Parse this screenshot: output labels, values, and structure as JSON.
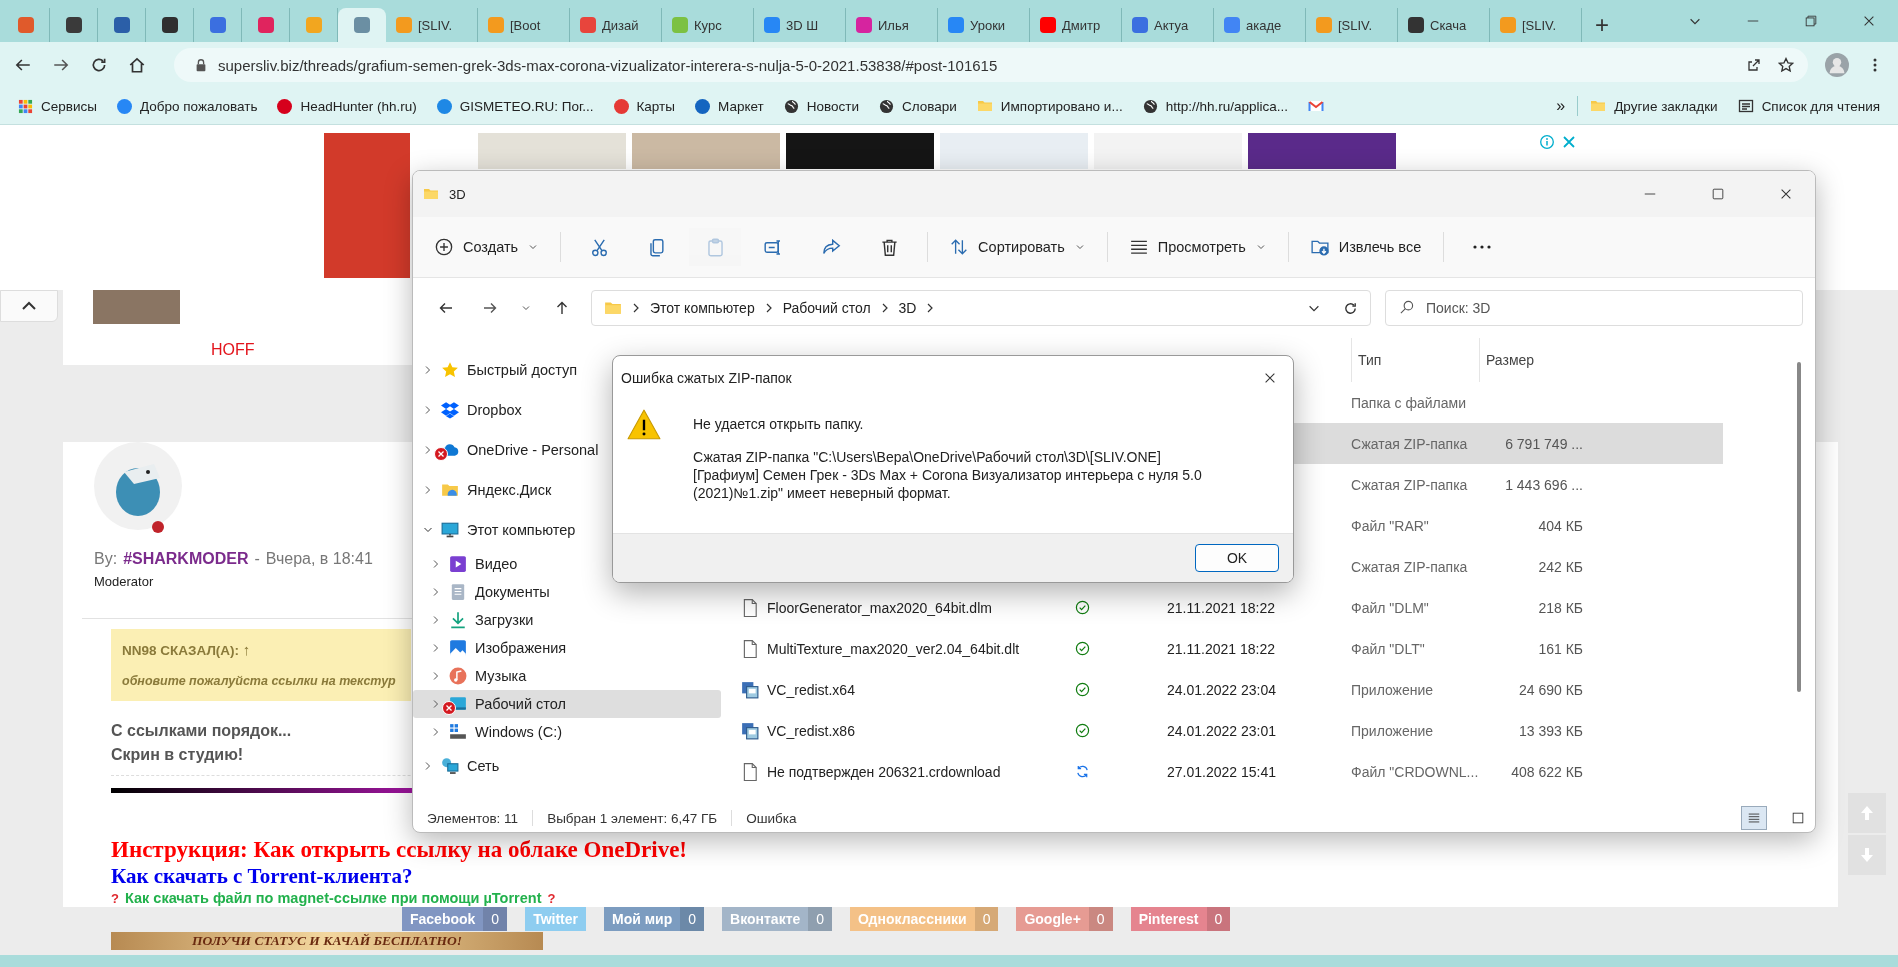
{
  "browser": {
    "tabs": [
      {
        "color": "#e05a2b",
        "selected": false
      },
      {
        "color": "#3a3a3a",
        "selected": false
      },
      {
        "color": "#2b5fa8",
        "selected": false
      },
      {
        "color": "#2f2f2f",
        "selected": false
      },
      {
        "color": "#3b6fe0",
        "selected": false
      },
      {
        "color": "#e0245e",
        "selected": false
      },
      {
        "color": "#f2a61f",
        "selected": false
      },
      {
        "color": "#6b8fa3",
        "selected": true
      },
      {
        "title": "[SLIV.",
        "color": "#f39a1e",
        "selected": false
      },
      {
        "title": "[Boot",
        "color": "#f39a1e",
        "selected": false
      },
      {
        "title": "Дизай",
        "color": "#e8453c",
        "selected": false
      },
      {
        "title": "Курс",
        "color": "#7cc142",
        "selected": false
      },
      {
        "title": "3D Ш",
        "color": "#2787f5",
        "selected": false
      },
      {
        "title": "Илья",
        "color": "#d6249f",
        "selected": false
      },
      {
        "title": "Уроки",
        "color": "#2787f5",
        "selected": false
      },
      {
        "title": "Дмитр",
        "color": "#ff0000",
        "selected": false
      },
      {
        "title": "Актуа",
        "color": "#3b6fe0",
        "selected": false
      },
      {
        "title": "акаде",
        "color": "#4285f4",
        "selected": false
      },
      {
        "title": "[SLIV.",
        "color": "#f39a1e",
        "selected": false
      },
      {
        "title": "Скача",
        "color": "#333333",
        "selected": false
      },
      {
        "title": "[SLIV.",
        "color": "#f39a1e",
        "selected": false
      }
    ],
    "new_tab": "+",
    "url": "supersliv.biz/threads/grafium-semen-grek-3ds-max-corona-vizualizator-interera-s-nulja-5-0-2021.53838/#post-101615",
    "bookmarks": [
      {
        "kind": "apps",
        "label": "Сервисы"
      },
      {
        "kind": "site",
        "label": "Добро пожаловать",
        "color": "#2787f5"
      },
      {
        "kind": "site",
        "label": "HeadHunter (hh.ru)",
        "color": "#d6001c"
      },
      {
        "kind": "site",
        "label": "GISMETEO.RU: Пог...",
        "color": "#1e88e5"
      },
      {
        "kind": "site",
        "label": "Карты",
        "color": "#e53935"
      },
      {
        "kind": "site",
        "label": "Маркет",
        "color": "#1565c0"
      },
      {
        "kind": "globe",
        "label": "Новости"
      },
      {
        "kind": "globe",
        "label": "Словари"
      },
      {
        "kind": "folder",
        "label": "Импортировано и..."
      },
      {
        "kind": "globe",
        "label": "http://hh.ru/applica..."
      },
      {
        "kind": "mail"
      },
      {
        "kind": "more",
        "label": "»"
      },
      {
        "kind": "folder",
        "label": "Другие закладки"
      },
      {
        "kind": "list",
        "label": "Список для чтения"
      }
    ]
  },
  "page": {
    "ad_covers": [
      {
        "color": "#d23a2a"
      },
      {
        "color": "#e4e1d8"
      },
      {
        "color": "#cbb9a3"
      },
      {
        "color": "#151515"
      },
      {
        "color": "#e8eef3"
      },
      {
        "color": "#f3f3f3"
      },
      {
        "color": "#5a2a8a"
      }
    ],
    "hoff_caption": "HOFF",
    "post": {
      "author_prefix": "By:",
      "author": "#SHARKMODER",
      "separator": "-",
      "time": "Вчера, в 18:41",
      "role": "Moderator",
      "online": false,
      "quote": {
        "header": "NN98 СКАЗАЛ(А):",
        "arrow": "↑",
        "text": "обновите пожалуйста ссылки на текстур"
      },
      "lines": [
        "С ссылками порядок...",
        "Скрин в студию!"
      ],
      "links": [
        {
          "kind": "instruction",
          "text": "Инструкция: Как открыть ссылку на облаке OneDrive!"
        },
        {
          "kind": "torrent",
          "text": "Как скачать с Torrent-клиента?"
        },
        {
          "kind": "magnet",
          "text": "Как скачать файл по magnet-ссылке при помощи µTorrent",
          "mark": "?"
        }
      ]
    },
    "share": [
      {
        "label": "Facebook",
        "count": "0",
        "color": "#8196c2"
      },
      {
        "label": "Twitter",
        "color": "#8ecdf0"
      },
      {
        "label": "Мой мир",
        "count": "0",
        "color": "#7c9cc0"
      },
      {
        "label": "Вконтакте",
        "count": "0",
        "color": "#a3b5c8"
      },
      {
        "label": "Одноклассники",
        "count": "0",
        "color": "#f4c187"
      },
      {
        "label": "Google+",
        "count": "0",
        "color": "#e69b93"
      },
      {
        "label": "Pinterest",
        "count": "0",
        "color": "#e5848f"
      }
    ],
    "banner": "ПОЛУЧИ СТАТУС И КАЧАЙ БЕСПЛАТНО!"
  },
  "explorer": {
    "title": "3D",
    "toolbar": [
      {
        "kind": "menu",
        "label": "Создать",
        "dropdown": true
      },
      {
        "kind": "separator"
      },
      {
        "kind": "icon",
        "disabled": false
      },
      {
        "kind": "icon",
        "disabled": false
      },
      {
        "kind": "icon",
        "disabled": true
      },
      {
        "kind": "icon",
        "disabled": false
      },
      {
        "kind": "icon",
        "disabled": false
      },
      {
        "kind": "icon",
        "disabled": false
      },
      {
        "kind": "separator"
      },
      {
        "kind": "menu",
        "label": "Сортировать",
        "dropdown": true
      },
      {
        "kind": "separator"
      },
      {
        "kind": "menu",
        "label": "Просмотреть",
        "dropdown": true
      },
      {
        "kind": "separator"
      },
      {
        "kind": "menu",
        "label": "Извлечь все",
        "dropdown": false
      },
      {
        "kind": "separator"
      },
      {
        "kind": "more"
      }
    ],
    "breadcrumb": [
      "Этот компьютер",
      "Рабочий стол",
      "3D"
    ],
    "search": {
      "placeholder": "Поиск: 3D"
    },
    "tree": [
      {
        "label": "Быстрый доступ",
        "expanded": false,
        "selected": false,
        "error": false
      },
      {
        "label": "Dropbox",
        "expanded": false,
        "selected": false,
        "error": false
      },
      {
        "label": "OneDrive - Personal",
        "expanded": false,
        "selected": false,
        "error": true
      },
      {
        "label": "Яндекс.Диск",
        "expanded": false,
        "selected": false,
        "error": false
      },
      {
        "label": "Этот компьютер",
        "expanded": true,
        "selected": false,
        "error": false,
        "children": [
          {
            "label": "Видео",
            "expanded": false,
            "selected": false,
            "error": false
          },
          {
            "label": "Документы",
            "expanded": false,
            "selected": false,
            "error": false
          },
          {
            "label": "Загрузки",
            "expanded": false,
            "selected": false,
            "error": false
          },
          {
            "label": "Изображения",
            "expanded": false,
            "selected": false,
            "error": false
          },
          {
            "label": "Музыка",
            "expanded": false,
            "selected": false,
            "error": false
          },
          {
            "label": "Рабочий стол",
            "expanded": false,
            "selected": true,
            "error": true
          },
          {
            "label": "Windows (C:)",
            "expanded": false,
            "selected": false,
            "error": false
          }
        ]
      },
      {
        "label": "Сеть",
        "expanded": false,
        "selected": false,
        "error": false
      }
    ],
    "columns": [
      "Тип",
      "Размер"
    ],
    "rows": [
      {
        "type": "Папка с файлами",
        "selected": false
      },
      {
        "type": "Сжатая ZIP-папка",
        "size": "6 791 749 ...",
        "selected": true
      },
      {
        "type": "Сжатая ZIP-папка",
        "size": "1 443 696 ...",
        "selected": false
      },
      {
        "type": "Файл \"RAR\"",
        "size": "404 КБ",
        "selected": false
      },
      {
        "type": "Сжатая ZIP-папка",
        "size": "242 КБ",
        "selected": false
      },
      {
        "kind": "file",
        "name": "FloorGenerator_max2020_64bit.dlm",
        "syncing": false,
        "date": "21.11.2021 18:22",
        "type": "Файл \"DLM\"",
        "size": "218 КБ",
        "selected": false
      },
      {
        "kind": "file",
        "name": "MultiTexture_max2020_ver2.04_64bit.dlt",
        "syncing": false,
        "date": "21.11.2021 18:22",
        "type": "Файл \"DLT\"",
        "size": "161 КБ",
        "selected": false
      },
      {
        "kind": "installer",
        "name": "VC_redist.x64",
        "syncing": false,
        "date": "24.01.2022 23:04",
        "type": "Приложение",
        "size": "24 690 КБ",
        "selected": false
      },
      {
        "kind": "installer",
        "name": "VC_redist.x86",
        "syncing": false,
        "date": "24.01.2022 23:01",
        "type": "Приложение",
        "size": "13 393 КБ",
        "selected": false
      },
      {
        "kind": "file",
        "name": "Не подтвержден 206321.crdownload",
        "syncing": true,
        "date": "27.01.2022 15:41",
        "type": "Файл \"CRDOWNL...",
        "size": "408 622 КБ",
        "selected": false
      }
    ],
    "status": {
      "count": "Элементов: 11",
      "selection": "Выбран 1 элемент: 6,47 ГБ",
      "error": "Ошибка"
    },
    "views": [
      {
        "selected": true
      },
      {
        "selected": false
      }
    ]
  },
  "dialog": {
    "title": "Ошибка сжатых ZIP-папок",
    "heading": "Не удается открыть папку.",
    "message": "Сжатая ZIP-папка \"C:\\Users\\Вера\\OneDrive\\Рабочий стол\\3D\\[SLIV.ONE] [Графиум] Семен Грек - 3Ds Max + Corona Визуализатор интерьера с нуля 5.0 (2021)№1.zip\" имеет неверный формат.",
    "button": "OK"
  }
}
